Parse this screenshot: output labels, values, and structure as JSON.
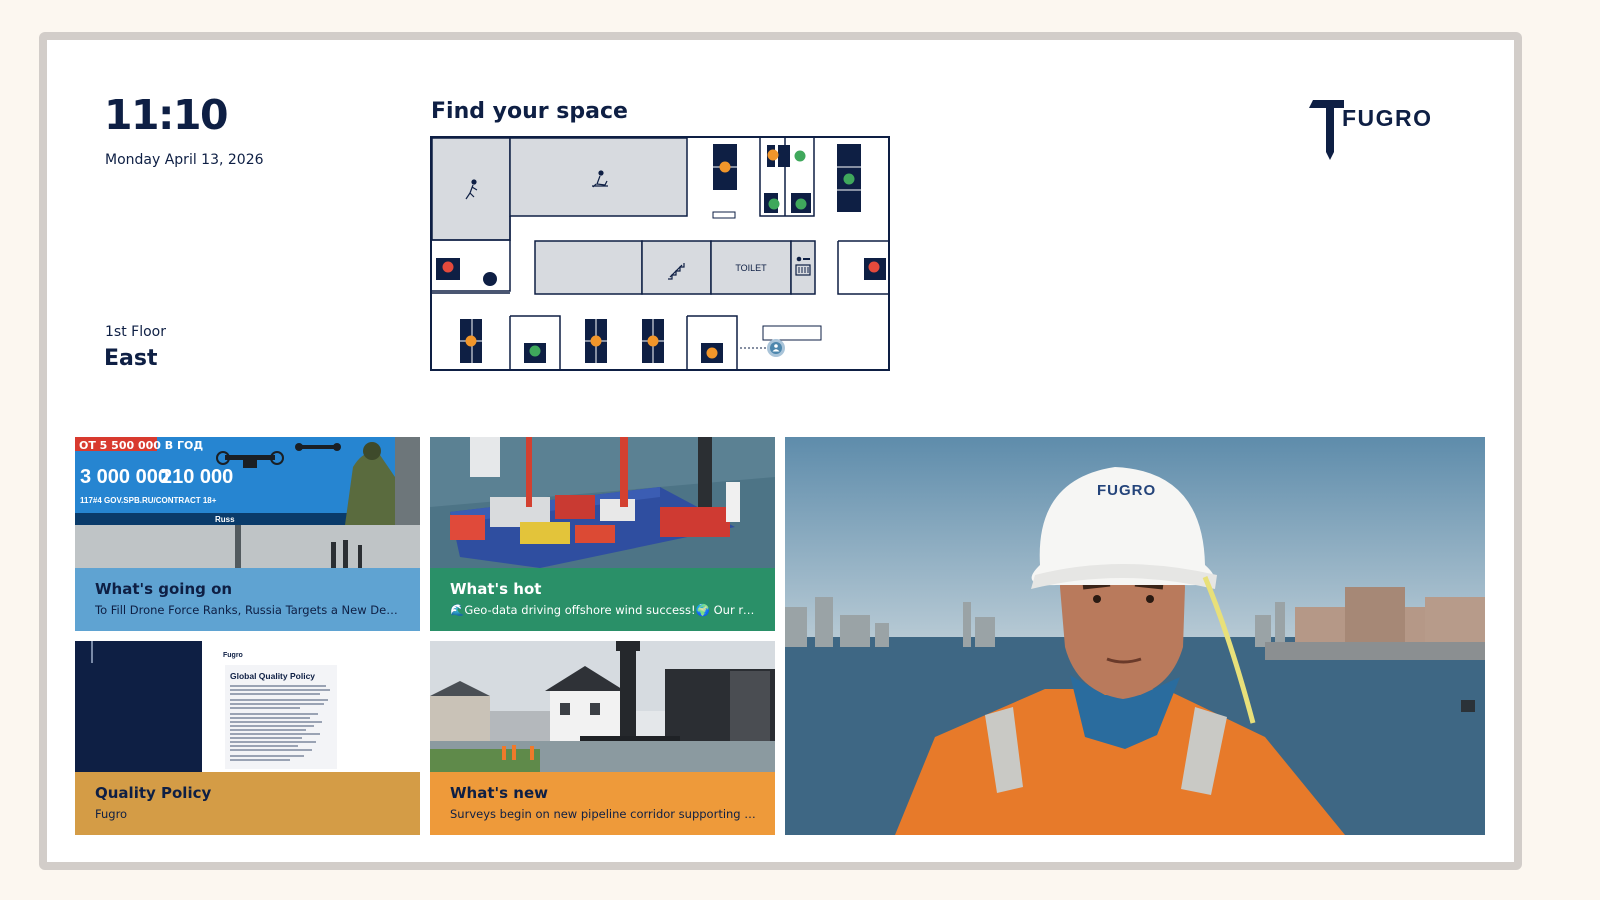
{
  "time": "11:10",
  "date": "Monday April 13, 2026",
  "location": {
    "floor": "1st Floor",
    "wing": "East"
  },
  "map": {
    "title": "Find your space",
    "toilet_label": "TOILET",
    "status_colors": {
      "available": "#3fa85c",
      "occupied": "#e44a3c",
      "booked": "#f2962a"
    }
  },
  "brand": {
    "logo_text": "FUGRO",
    "navy": "#0e1f44"
  },
  "tiles": [
    {
      "title": "What's going on",
      "subtitle": "To Fill Drone Force Ranks, Russia Targets a New Demographic",
      "color": "#5fa3d2"
    },
    {
      "title": "What's hot",
      "subtitle": "🌊Geo-data driving offshore wind success!🌍 Our recent work",
      "color": "#2a9068"
    },
    {
      "title": "Quality Policy",
      "subtitle": "Fugro",
      "color": "#d49c46"
    },
    {
      "title": "What's new",
      "subtitle": "Surveys begin on new pipeline corridor supporting Dutch energy",
      "color": "#ee9a3a"
    }
  ],
  "billboard": {
    "headline": "ОТ 5 500 000 В ГОД",
    "amount_1": "3 000 000",
    "amount_2": "210 000",
    "contact": "117#4  GOV.SPB.RU/CONTRACT  18+",
    "brand": "Russ"
  },
  "document": {
    "logo": "Fugro",
    "title": "Global Quality Policy"
  },
  "hero": {
    "helmet_logo": "FUGRO"
  }
}
